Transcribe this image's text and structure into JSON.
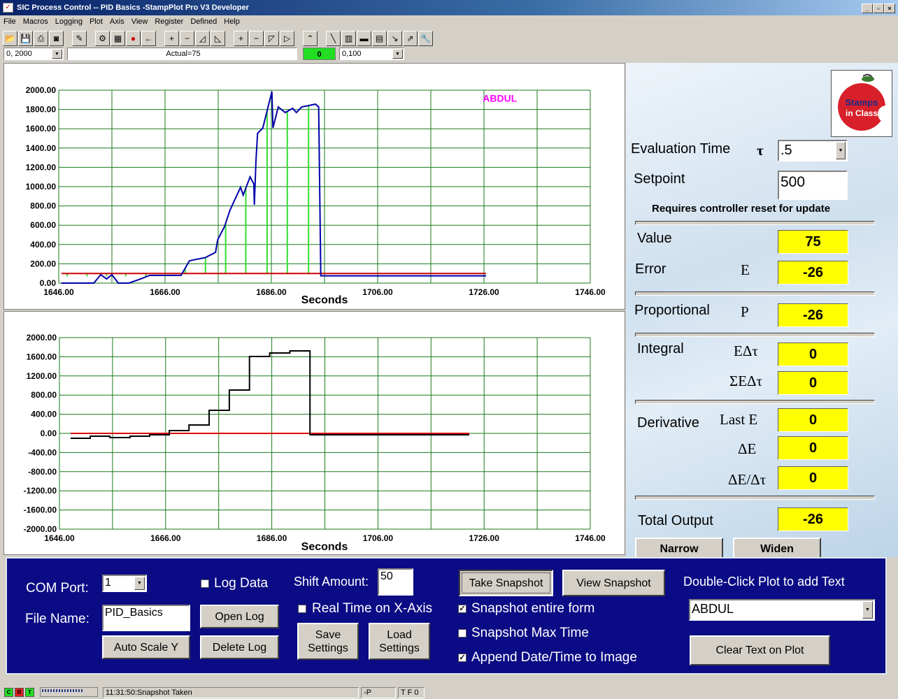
{
  "window": {
    "title": "SIC Process Control -- PID Basics -StampPlot Pro V3 Developer",
    "controls": [
      "_",
      "▫",
      "×"
    ]
  },
  "menu": [
    "File",
    "Macros",
    "Logging",
    "Plot",
    "Axis",
    "View",
    "Register",
    "Defined",
    "Help"
  ],
  "toolbar": {
    "icons": [
      [
        "open-folder-icon",
        "📂"
      ],
      [
        "save-icon",
        "💾"
      ],
      [
        "print-icon",
        "⎙"
      ],
      [
        "camera-icon",
        "◙"
      ],
      null,
      [
        "wand-icon",
        "✎"
      ],
      null,
      [
        "plot-run-icon",
        "⚙"
      ],
      [
        "grid-icon",
        "▦"
      ],
      [
        "stop-icon",
        "●"
      ],
      [
        "arrow-left-icon",
        "←"
      ],
      null,
      [
        "x-plus-icon",
        "+"
      ],
      [
        "x-minus-icon",
        "−"
      ],
      [
        "x-shift-left-icon",
        "◿"
      ],
      [
        "x-shift-right-icon",
        "◺"
      ],
      null,
      [
        "y-plus-icon",
        "+"
      ],
      [
        "y-minus-icon",
        "−"
      ],
      [
        "y-shift-down-icon",
        "◸"
      ],
      [
        "y-shift-up-icon",
        "▷"
      ],
      null,
      [
        "chart-icon",
        "⌃"
      ],
      null,
      [
        "pen-icon",
        "╲"
      ],
      [
        "digital-icon",
        "▥"
      ],
      [
        "note-icon",
        "▬"
      ],
      [
        "clipboard-icon",
        "▤"
      ],
      [
        "probe-icon",
        "↘"
      ],
      [
        "scale-icon",
        "⇗"
      ],
      [
        "wrench-icon",
        "🔧"
      ]
    ],
    "y_range": "0, 2000",
    "status_field": "Actual=75",
    "indicator": "0",
    "x_range": "0,100",
    "indicator_color": "#22dd22"
  },
  "chart_data": [
    {
      "type": "line",
      "xlabel": "Seconds",
      "ylabel": "",
      "xlim": [
        1646,
        1746
      ],
      "ylim": [
        0,
        2000
      ],
      "grid": true,
      "xticks": [
        "1646.00",
        "1666.00",
        "1686.00",
        "1706.00",
        "1726.00",
        "1746.00"
      ],
      "yticks": [
        "0.00",
        "200.00",
        "400.00",
        "600.00",
        "800.00",
        "1000.00",
        "1200.00",
        "1400.00",
        "1600.00",
        "1800.00",
        "2000.00"
      ],
      "annotation": {
        "text": "ABDUL",
        "x": 1729,
        "y": 1880,
        "color": "#ff00ff"
      },
      "series": [
        {
          "color": "#0000aa",
          "x": [
            1646.5,
            1652.6,
            1653.9,
            1655,
            1656,
            1657.2,
            1659.2,
            1661.4,
            1663.1,
            1669,
            1670.6,
            1673.6,
            1675.5,
            1675.9,
            1677.2,
            1678.2,
            1680.2,
            1680.7,
            1682,
            1682.7,
            1682.8,
            1683.1,
            1683.4,
            1684.4,
            1686.1,
            1686.3,
            1687.3,
            1688.6,
            1690,
            1690.7,
            1691.7,
            1694.3,
            1694.9,
            1695.3,
            1726.4
          ],
          "y": [
            0,
            0,
            87,
            43,
            87,
            0,
            0,
            43,
            80,
            80,
            232,
            265,
            319,
            449,
            587,
            754,
            993,
            913,
            1101,
            1028,
            812,
            1261,
            1551,
            1609,
            1986,
            1609,
            1826,
            1768,
            1812,
            1768,
            1826,
            1855,
            1826,
            75,
            75
          ]
        },
        {
          "color": "#cc0000",
          "x": [
            1646.5,
            1726.4
          ],
          "y": [
            100,
            100
          ]
        }
      ],
      "samples": {
        "color": "#33dd33",
        "x": [
          1647.6,
          1651.3,
          1655,
          1658.6,
          1662.4,
          1666,
          1669.8,
          1673.6,
          1677.4,
          1681.2,
          1685.2,
          1689,
          1693
        ]
      }
    },
    {
      "type": "line",
      "xlabel": "Seconds",
      "ylabel": "",
      "xlim": [
        1646,
        1746
      ],
      "ylim": [
        -2000,
        2000
      ],
      "grid": true,
      "xticks": [
        "1646.00",
        "1666.00",
        "1686.00",
        "1706.00",
        "1726.00",
        "1746.00"
      ],
      "yticks": [
        "-2000.00",
        "-1600.00",
        "-1200.00",
        "-800.00",
        "-400.00",
        "0.00",
        "400.00",
        "800.00",
        "1200.00",
        "1600.00",
        "2000.00"
      ],
      "series": [
        {
          "color": "#000000",
          "step": true,
          "x": [
            1648.1,
            1651.8,
            1655.5,
            1659.3,
            1663,
            1666.7,
            1670.4,
            1674.2,
            1678,
            1681.8,
            1685.6,
            1689.4,
            1693.2,
            1723.2
          ],
          "y": [
            -102,
            -58,
            -88,
            -58,
            -29,
            58,
            175,
            482,
            905,
            1606,
            1679,
            1723,
            -29,
            -29
          ]
        },
        {
          "color": "#dd0000",
          "x": [
            1648.1,
            1723.2
          ],
          "y": [
            0,
            0
          ]
        }
      ]
    }
  ],
  "right": {
    "logo": "Stamps in Class",
    "eval_label": "Evaluation Time",
    "tau": "τ",
    "eval_value": ".5",
    "setpoint_label": "Setpoint",
    "setpoint_value": "500",
    "reset_note": "Requires controller reset for update",
    "value_label": "Value",
    "value": "75",
    "error_label": "Error",
    "error_sym": "E",
    "error": "-26",
    "prop_label": "Proportional",
    "prop_sym": "P",
    "prop": "-26",
    "int_label": "Integral",
    "int_sym1": "EΔτ",
    "int1": "0",
    "int_sym2": "ΣEΔτ",
    "int2": "0",
    "deriv_label": "Derivative",
    "deriv_sym1": "Last E",
    "deriv1": "0",
    "deriv_sym2": "ΔE",
    "deriv2": "0",
    "deriv_sym3": "ΔE/Δτ",
    "deriv3": "0",
    "total_label": "Total Output",
    "total": "-26",
    "narrow": "Narrow",
    "widen": "Widen"
  },
  "bottom": {
    "com_label": "COM Port:",
    "com_value": "1",
    "file_label": "File Name:",
    "file_value": "PID_Basics",
    "log_data": "Log Data",
    "log_checked": false,
    "open_log": "Open Log",
    "delete_log": "Delete Log",
    "auto_scale": "Auto Scale Y",
    "shift_label": "Shift Amount:",
    "shift_value": "50",
    "real_time": "Real Time on X-Axis",
    "real_time_checked": false,
    "save_settings": "Save\nSettings",
    "load_settings": "Load\nSettings",
    "take_snapshot": "Take Snapshot",
    "view_snapshot": "View Snapshot",
    "snap_form": "Snapshot entire form",
    "snap_form_checked": true,
    "snap_max": "Snapshot Max Time",
    "snap_max_checked": false,
    "append_dt": "Append Date/Time to Image",
    "append_dt_checked": true,
    "dbl_click": "Double-Click Plot to add Text",
    "text_value": "ABDUL",
    "clear_text": "Clear Text on Plot"
  },
  "status": {
    "c": "C",
    "r": "R",
    "t": "T",
    "message": "11:31:50:Snapshot Taken",
    "mode": "-P",
    "flags": "T F 0"
  }
}
